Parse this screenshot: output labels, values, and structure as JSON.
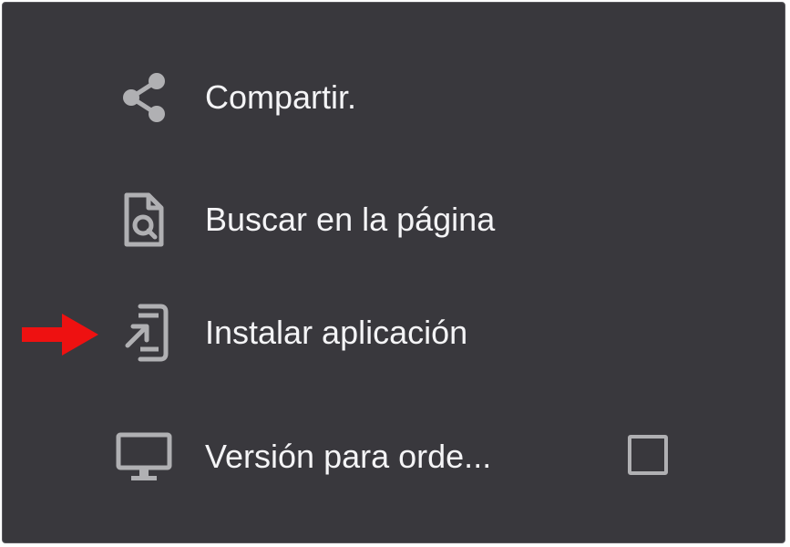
{
  "menu": {
    "items": [
      {
        "label": "Compartir.",
        "icon": "share-icon"
      },
      {
        "label": "Buscar en la página",
        "icon": "find-in-page-icon"
      },
      {
        "label": "Instalar aplicación",
        "icon": "install-app-icon"
      },
      {
        "label": "Versión para orde...",
        "icon": "desktop-icon",
        "checked": false
      }
    ]
  },
  "colors": {
    "menu_background": "#39383d",
    "text": "#f4f4f6",
    "icon": "#b0b0b3",
    "annotation_arrow": "#ee1111"
  }
}
